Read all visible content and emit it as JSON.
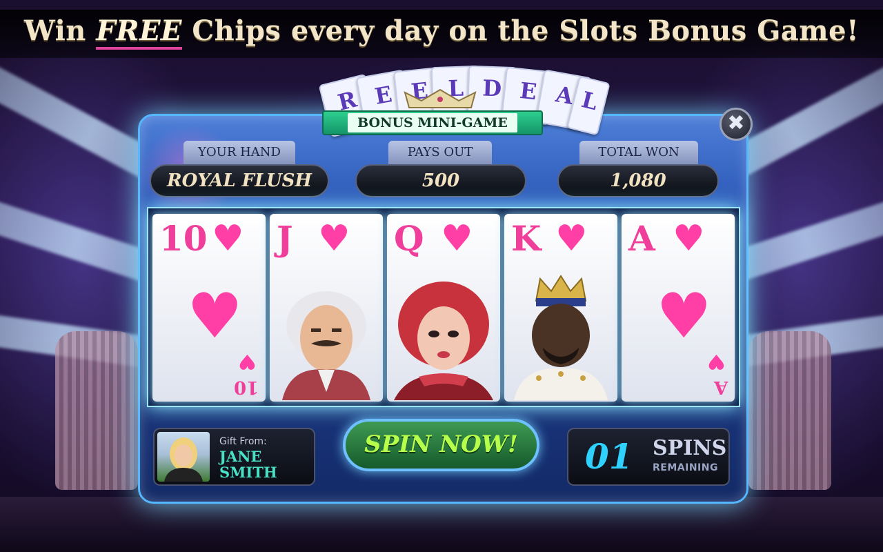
{
  "headline": {
    "pre": "Win ",
    "highlight": "FREE",
    "post": " Chips every day on the Slots Bonus Game!"
  },
  "game": {
    "title_letters": [
      "R",
      "E",
      "E",
      "L",
      "D",
      "E",
      "A",
      "L"
    ],
    "badge": "BONUS MINI-GAME"
  },
  "stats": {
    "your_hand": {
      "label": "YOUR HAND",
      "value": "ROYAL FLUSH"
    },
    "pays_out": {
      "label": "PAYS OUT",
      "value": "500"
    },
    "total_won": {
      "label": "TOTAL WON",
      "value": "1,080"
    }
  },
  "cards": [
    {
      "rank": "10",
      "suit": "heart",
      "type": "number"
    },
    {
      "rank": "J",
      "suit": "heart",
      "type": "face"
    },
    {
      "rank": "Q",
      "suit": "heart",
      "type": "face"
    },
    {
      "rank": "K",
      "suit": "heart",
      "type": "face"
    },
    {
      "rank": "A",
      "suit": "heart",
      "type": "number"
    }
  ],
  "gift": {
    "from_label": "Gift From:",
    "name_first": "JANE",
    "name_last": "SMITH"
  },
  "spin_button": "SPIN NOW!",
  "spins": {
    "count": "01",
    "label": "SPINS",
    "sub": "REMAINING"
  },
  "icons": {
    "close": "close-icon",
    "suit": "heart-icon",
    "crown": "crown-icon"
  },
  "colors": {
    "suit": "#ff3fa6",
    "accent_cyan": "#2fd2ff",
    "spin_text": "#b6ff4b",
    "badge": "#2ecf8e"
  }
}
